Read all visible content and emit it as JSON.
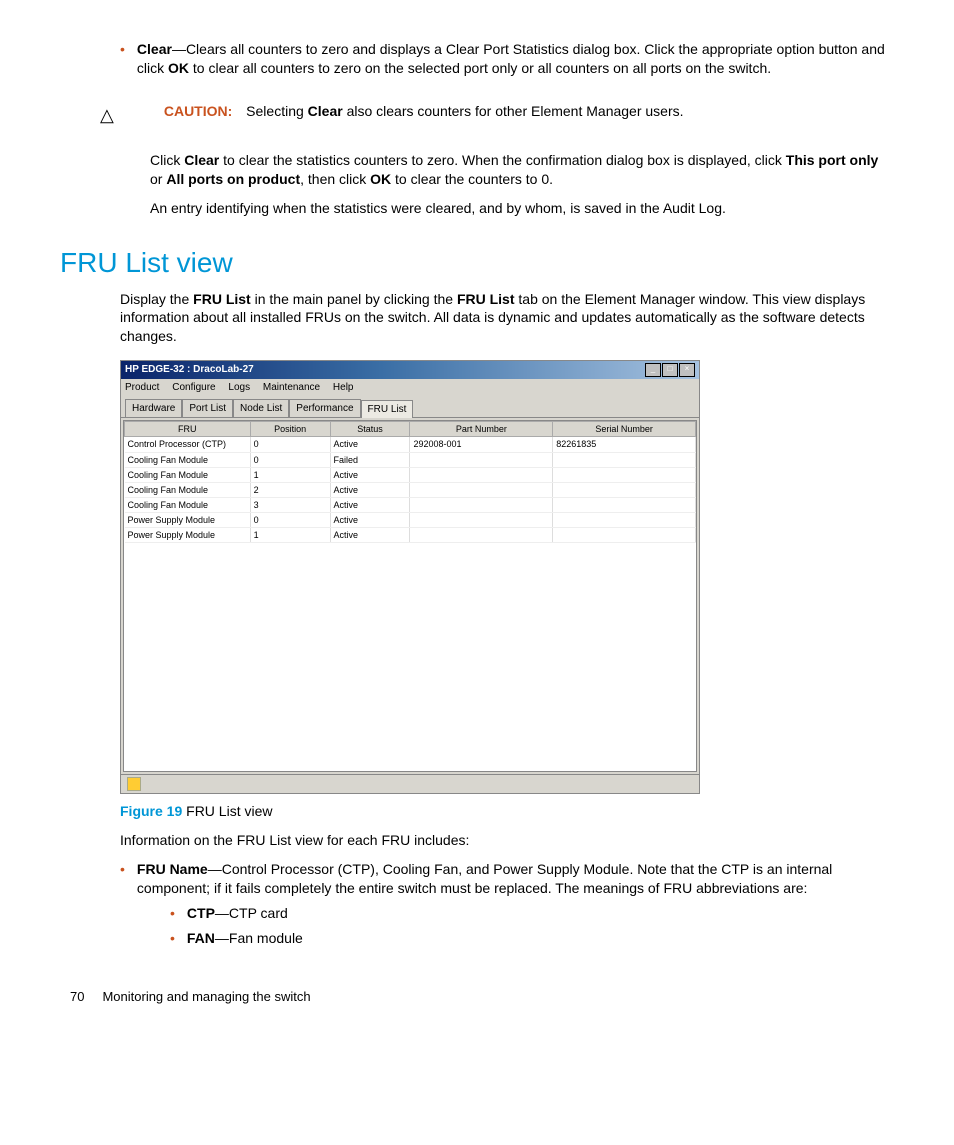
{
  "bullet_clear": {
    "label": "Clear",
    "text1": "—Clears all counters to zero and displays a Clear Port Statistics dialog box. Click the appropriate option button and click ",
    "ok": "OK",
    "text2": " to clear all counters to zero on the selected port only or all counters on all ports on the switch."
  },
  "caution": {
    "label": "CAUTION:",
    "text1": "Selecting ",
    "bold": "Clear",
    "text2": " also clears counters for other Element Manager users."
  },
  "para1": {
    "t1": "Click ",
    "b1": "Clear",
    "t2": " to clear the statistics counters to zero. When the confirmation dialog box is displayed, click ",
    "b2": "This port only",
    "t3": " or ",
    "b3": "All ports on product",
    "t4": ", then click ",
    "b4": "OK",
    "t5": " to clear the counters to 0."
  },
  "para2": "An entry identifying when the statistics were cleared, and by whom, is saved in the Audit Log.",
  "heading": "FRU List view",
  "intro": {
    "t1": "Display the ",
    "b1": "FRU List",
    "t2": " in the main panel by clicking the ",
    "b2": "FRU List",
    "t3": " tab on the Element Manager window. This view displays information about all installed FRUs on the switch. All data is dynamic and updates automatically as the software detects changes."
  },
  "window": {
    "title": "HP EDGE-32 : DracoLab-27",
    "menu": [
      "Product",
      "Configure",
      "Logs",
      "Maintenance",
      "Help"
    ],
    "tabs": [
      "Hardware",
      "Port List",
      "Node List",
      "Performance",
      "FRU List"
    ],
    "active_tab": 4,
    "columns": [
      "FRU",
      "Position",
      "Status",
      "Part Number",
      "Serial Number"
    ],
    "rows": [
      {
        "fru": "Control Processor (CTP)",
        "pos": "0",
        "status": "Active",
        "part": "292008-001",
        "serial": "82261835"
      },
      {
        "fru": "Cooling Fan Module",
        "pos": "0",
        "status": "Failed",
        "part": "",
        "serial": ""
      },
      {
        "fru": "Cooling Fan Module",
        "pos": "1",
        "status": "Active",
        "part": "",
        "serial": ""
      },
      {
        "fru": "Cooling Fan Module",
        "pos": "2",
        "status": "Active",
        "part": "",
        "serial": ""
      },
      {
        "fru": "Cooling Fan Module",
        "pos": "3",
        "status": "Active",
        "part": "",
        "serial": ""
      },
      {
        "fru": "Power Supply Module",
        "pos": "0",
        "status": "Active",
        "part": "",
        "serial": ""
      },
      {
        "fru": "Power Supply Module",
        "pos": "1",
        "status": "Active",
        "part": "",
        "serial": ""
      }
    ]
  },
  "figure": {
    "label": "Figure 19",
    "caption": " FRU List view"
  },
  "info_line": "Information on the FRU List view for each FRU includes:",
  "fru_name_bullet": {
    "label": "FRU Name",
    "text": "—Control Processor (CTP), Cooling Fan, and Power Supply Module. Note that the CTP is an internal component; if it fails completely the entire switch must be replaced. The meanings of FRU abbreviations are:"
  },
  "sub_bullets": [
    {
      "b": "CTP",
      "t": "—CTP card"
    },
    {
      "b": "FAN",
      "t": "—Fan module"
    }
  ],
  "footer": {
    "page": "70",
    "chapter": "Monitoring and managing the switch"
  }
}
